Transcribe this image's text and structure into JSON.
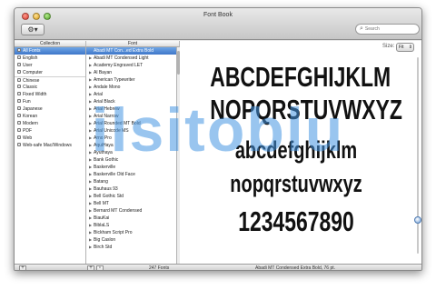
{
  "window": {
    "title": "Font Book"
  },
  "toolbar": {
    "gear_glyph": "⚙▾",
    "search_placeholder": "Search"
  },
  "columns": {
    "collection": "Collection",
    "font": "Font"
  },
  "collections": [
    {
      "label": "All Fonts",
      "icon": "all-fonts-icon",
      "selected": true
    },
    {
      "label": "English",
      "icon": "english-icon"
    },
    {
      "label": "User",
      "icon": "user-icon"
    },
    {
      "label": "Computer",
      "icon": "computer-icon"
    },
    {
      "label": "Chinese",
      "icon": "collection-icon",
      "divider": true
    },
    {
      "label": "Classic",
      "icon": "collection-icon"
    },
    {
      "label": "Fixed Width",
      "icon": "collection-icon"
    },
    {
      "label": "Fun",
      "icon": "collection-icon"
    },
    {
      "label": "Japanese",
      "icon": "collection-icon"
    },
    {
      "label": "Korean",
      "icon": "collection-icon"
    },
    {
      "label": "Modern",
      "icon": "collection-icon"
    },
    {
      "label": "PDF",
      "icon": "collection-icon"
    },
    {
      "label": "Web",
      "icon": "collection-icon"
    },
    {
      "label": "Web-safe Mac/Windows",
      "icon": "collection-icon"
    }
  ],
  "fonts": [
    {
      "label": "Abadi MT Con...ed Extra Bold",
      "selected": true
    },
    {
      "label": "Abadi MT Condensed Light"
    },
    {
      "label": "Academy Engraved LET"
    },
    {
      "label": "Al Bayan"
    },
    {
      "label": "American Typewriter"
    },
    {
      "label": "Andale Mono"
    },
    {
      "label": "Arial"
    },
    {
      "label": "Arial Black"
    },
    {
      "label": "Arial Hebrew"
    },
    {
      "label": "Arial Narrow"
    },
    {
      "label": "Arial Rounded MT Bold"
    },
    {
      "label": "Arial Unicode MS"
    },
    {
      "label": "Arno Pro"
    },
    {
      "label": "AquiHaya"
    },
    {
      "label": "Ayuthaya"
    },
    {
      "label": "Bank Gothic"
    },
    {
      "label": "Baskerville"
    },
    {
      "label": "Baskerville Old Face"
    },
    {
      "label": "Batang"
    },
    {
      "label": "Bauhaus 93"
    },
    {
      "label": "Bell Gothic Std"
    },
    {
      "label": "Bell MT"
    },
    {
      "label": "Bernard MT Condensed"
    },
    {
      "label": "BiauKai"
    },
    {
      "label": "BiblaLS"
    },
    {
      "label": "Bickham Script Pro"
    },
    {
      "label": "Big Caslon"
    },
    {
      "label": "Birch Std"
    }
  ],
  "preview": {
    "size_label": "Size:",
    "size_value": "Fit",
    "lines": [
      "ABCDEFGHIJKLM",
      "NOPQRSTUVWXYZ",
      "abcdefghijklm",
      "nopqrstuvwxyz",
      "1234567890"
    ]
  },
  "status": {
    "font_count": "247 Fonts",
    "selection": "Abadi MT Condensed Extra Bold, 76 pt."
  },
  "watermark": {
    "text": "ilsitoblu"
  }
}
